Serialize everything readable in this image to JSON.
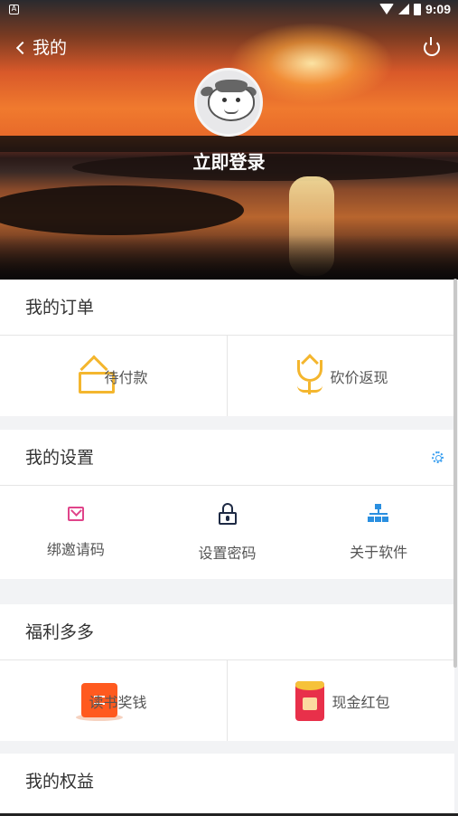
{
  "status_bar": {
    "time": "9:09",
    "left_icon_text": "A"
  },
  "nav": {
    "back_label": "我的",
    "back_icon": "chevron-left-icon",
    "power_icon": "power-icon"
  },
  "profile": {
    "avatar_icon": "cow-avatar-icon",
    "login_label": "立即登录"
  },
  "orders": {
    "title": "我的订单",
    "items": [
      {
        "label": "待付款",
        "icon": "house-icon"
      },
      {
        "label": "砍价返现",
        "icon": "tulip-icon"
      }
    ]
  },
  "settings": {
    "title": "我的设置",
    "title_icon": "gear-icon",
    "items": [
      {
        "label": "绑邀请码",
        "icon": "mail-icon"
      },
      {
        "label": "设置密码",
        "icon": "lock-icon"
      },
      {
        "label": "关于软件",
        "icon": "sitemap-icon"
      }
    ]
  },
  "welfare": {
    "title": "福利多多",
    "items": [
      {
        "label": "读书奖钱",
        "icon": "orange-box-icon"
      },
      {
        "label": "现金红包",
        "icon": "red-envelope-icon"
      }
    ]
  },
  "rights": {
    "title": "我的权益"
  },
  "colors": {
    "accent_yellow": "#f4b62e",
    "gear_blue": "#3a9ff0",
    "background": "#f2f3f5"
  }
}
